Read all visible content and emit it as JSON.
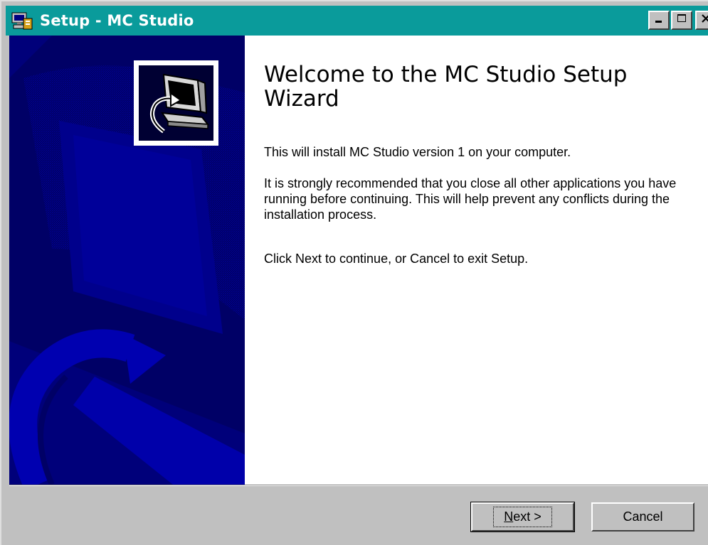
{
  "window": {
    "title": "Setup - MC Studio",
    "titlebar_color": "#0a9b9b"
  },
  "titlebar_buttons": {
    "minimize_icon": "minimize-icon",
    "maximize_icon": "maximize-icon",
    "close_icon": "close-icon"
  },
  "wizard": {
    "heading": "Welcome to the MC Studio Setup Wizard",
    "paragraph1": "This will install MC Studio version 1 on your computer.",
    "paragraph2": "It is strongly recommended that you close all other applications you have running before continuing. This will help prevent any conflicts during the installation process.",
    "paragraph3": "Click Next to continue, or Cancel to exit Setup.",
    "sidepanel_color": "#000066",
    "sidepanel_icon": "computer-install-icon"
  },
  "buttons": {
    "next_label": "Next >",
    "cancel_label": "Cancel"
  }
}
